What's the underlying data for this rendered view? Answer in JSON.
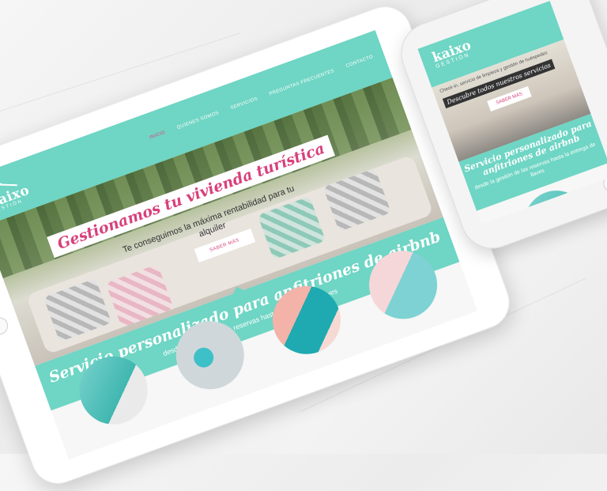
{
  "tablet": {
    "logo": {
      "brand": "kaixo",
      "sub": "GESTIÓN"
    },
    "nav": [
      "INICIO",
      "QUIENES SOMOS",
      "SERVICIOS",
      "PREGUNTAS FRECUENTES",
      "CONTACTO"
    ],
    "hero": {
      "title": "Gestionamos tu vivienda turística",
      "subtitle": "Te conseguimos la máxima rentabilidad para tu alquiler",
      "button": "SABER MÁS"
    },
    "band": {
      "title": "Servicio personalizado para anfitriones de airbnb",
      "subtitle": "desde la gestión de las reservas hasta la entrega de llaves"
    }
  },
  "phone": {
    "logo": {
      "brand": "kaixo",
      "sub": "GESTIÓN"
    },
    "hero": {
      "text": "Check-in, servicio de limpieza y gestión de huéspedes",
      "descubre": "Descubre todos nuestros servicios",
      "button": "SABER MÁS"
    },
    "band": {
      "title": "Servicio personalizado para anfitriones de airbnb",
      "subtitle": "desde la gestión de las reservas hasta la entrega de llaves"
    }
  },
  "colors": {
    "accent": "#6fd5c4",
    "brand_pink": "#d8407a"
  }
}
